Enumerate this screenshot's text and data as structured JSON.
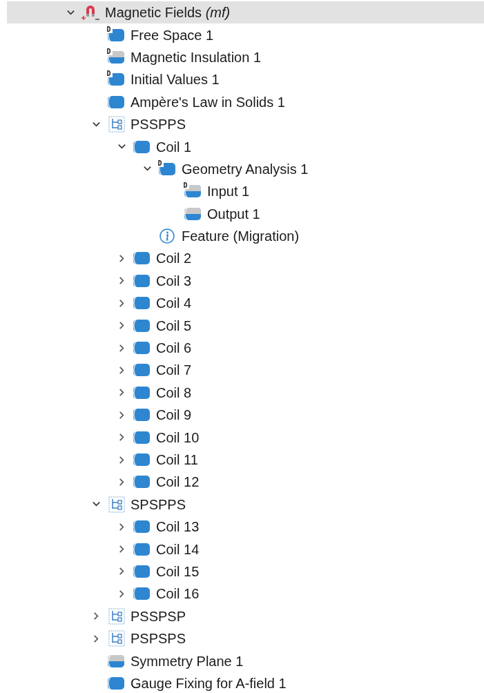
{
  "tree": [
    {
      "label": "Magnetic Fields *(mf)*",
      "kind": "physics",
      "expanded": true,
      "selected": true,
      "children": [
        {
          "label": "Free Space 1",
          "kind": "domain",
          "badge": "D",
          "selected": false
        },
        {
          "label": "Magnetic Insulation 1",
          "kind": "boundary",
          "badge": "D",
          "selected": false
        },
        {
          "label": "Initial Values 1",
          "kind": "domain",
          "badge": "D",
          "selected": false
        },
        {
          "label": "Ampère's Law in Solids 1",
          "kind": "domain",
          "selected": false
        },
        {
          "label": "PSSPPS",
          "kind": "group",
          "expanded": true,
          "selected": false,
          "children": [
            {
              "label": "Coil 1",
              "kind": "domain",
              "expanded": true,
              "selected": false,
              "children": [
                {
                  "label": "Geometry Analysis 1",
                  "kind": "domain",
                  "badge": "D",
                  "expanded": true,
                  "selected": false,
                  "children": [
                    {
                      "label": "Input 1",
                      "kind": "boundary",
                      "badge": "D",
                      "selected": false
                    },
                    {
                      "label": "Output  1",
                      "kind": "boundary",
                      "selected": false
                    }
                  ]
                },
                {
                  "label": "Feature (Migration)",
                  "kind": "info",
                  "selected": false
                }
              ]
            },
            {
              "label": "Coil 2",
              "kind": "domain",
              "expanded": false,
              "selected": false
            },
            {
              "label": "Coil 3",
              "kind": "domain",
              "expanded": false,
              "selected": false
            },
            {
              "label": "Coil 4",
              "kind": "domain",
              "expanded": false,
              "selected": false
            },
            {
              "label": "Coil 5",
              "kind": "domain",
              "expanded": false,
              "selected": false
            },
            {
              "label": "Coil 6",
              "kind": "domain",
              "expanded": false,
              "selected": false
            },
            {
              "label": "Coil 7",
              "kind": "domain",
              "expanded": false,
              "selected": false
            },
            {
              "label": "Coil 8",
              "kind": "domain",
              "expanded": false,
              "selected": false
            },
            {
              "label": "Coil 9",
              "kind": "domain",
              "expanded": false,
              "selected": false
            },
            {
              "label": "Coil 10",
              "kind": "domain",
              "expanded": false,
              "selected": false
            },
            {
              "label": "Coil 11",
              "kind": "domain",
              "expanded": false,
              "selected": false
            },
            {
              "label": "Coil 12",
              "kind": "domain",
              "expanded": false,
              "selected": false
            }
          ]
        },
        {
          "label": "SPSPPS",
          "kind": "group",
          "expanded": true,
          "selected": false,
          "children": [
            {
              "label": "Coil 13",
              "kind": "domain",
              "expanded": false,
              "selected": false
            },
            {
              "label": "Coil 14",
              "kind": "domain",
              "expanded": false,
              "selected": false
            },
            {
              "label": "Coil 15",
              "kind": "domain",
              "expanded": false,
              "selected": false
            },
            {
              "label": "Coil 16",
              "kind": "domain",
              "expanded": false,
              "selected": false
            }
          ]
        },
        {
          "label": "PSSPSP",
          "kind": "group",
          "expanded": false,
          "selected": false
        },
        {
          "label": "PSPSPS",
          "kind": "group",
          "expanded": false,
          "selected": false
        },
        {
          "label": "Symmetry Plane 1",
          "kind": "boundary",
          "selected": false
        },
        {
          "label": "Gauge Fixing for A-field 1",
          "kind": "domain",
          "selected": false
        }
      ]
    }
  ]
}
